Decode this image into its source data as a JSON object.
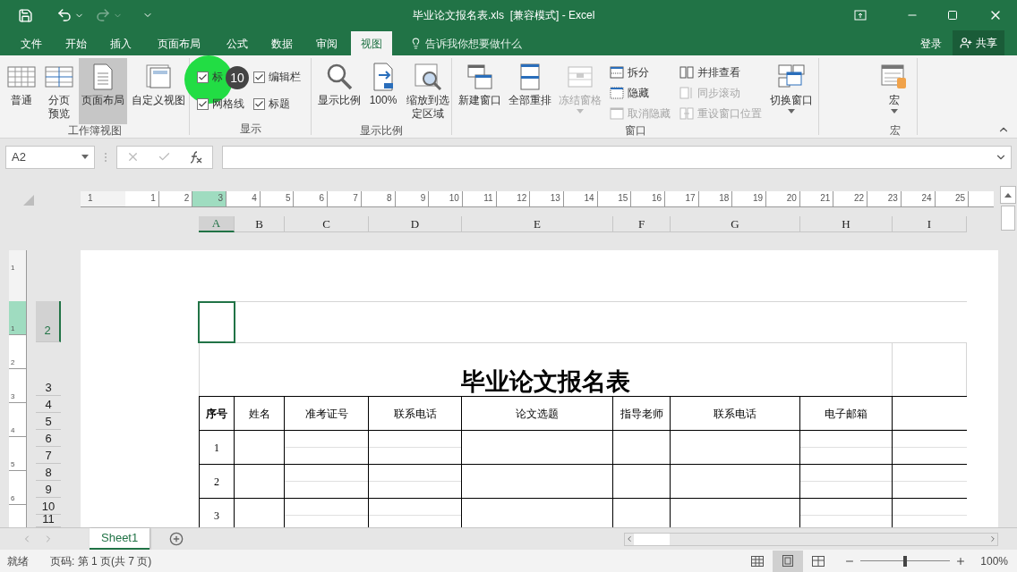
{
  "title_bar": {
    "title": "毕业论文报名表.xls  [兼容模式] - Excel"
  },
  "menu_tabs": [
    {
      "label": "文件",
      "selected": false
    },
    {
      "label": "开始",
      "selected": false
    },
    {
      "label": "插入",
      "selected": false
    },
    {
      "label": "页面布局",
      "selected": false
    },
    {
      "label": "公式",
      "selected": false
    },
    {
      "label": "数据",
      "selected": false
    },
    {
      "label": "审阅",
      "selected": false
    },
    {
      "label": "视图",
      "selected": true
    }
  ],
  "tell_me": {
    "placeholder": "告诉我你想要做什么"
  },
  "account": {
    "sign_in": "登录",
    "share": "共享"
  },
  "ribbon": {
    "groups": [
      {
        "label": "工作簿视图",
        "items": [
          {
            "kind": "large",
            "label": "普通",
            "selected": false
          },
          {
            "kind": "large",
            "label": "分页预览",
            "selected": false
          },
          {
            "kind": "large",
            "label": "页面布局",
            "selected": true
          },
          {
            "kind": "large",
            "label": "自定义视图",
            "selected": false
          }
        ]
      },
      {
        "label": "显示",
        "items": [
          {
            "kind": "stack",
            "items": [
              {
                "kind": "check",
                "label": "标",
                "checked": true
              },
              {
                "kind": "check",
                "label": "网格线",
                "checked": true
              }
            ]
          },
          {
            "kind": "stack",
            "items": [
              {
                "kind": "check",
                "label": "编辑栏",
                "checked": true
              },
              {
                "kind": "check",
                "label": "标题",
                "checked": true
              }
            ]
          }
        ]
      },
      {
        "label": "显示比例",
        "items": [
          {
            "kind": "large",
            "label": "显示比例"
          },
          {
            "kind": "large",
            "label": "100%"
          },
          {
            "kind": "large",
            "label": "缩放到选定区域"
          }
        ]
      },
      {
        "label": "窗口",
        "items": [
          {
            "kind": "large",
            "label": "新建窗口",
            "disabled": false,
            "menu": false
          },
          {
            "kind": "large",
            "label": "全部重排",
            "disabled": false,
            "menu": false
          },
          {
            "kind": "large",
            "label": "冻结窗格",
            "disabled": true,
            "menu": true
          },
          {
            "kind": "stack",
            "items": [
              {
                "kind": "small",
                "label": "拆分",
                "disabled": false
              },
              {
                "kind": "small",
                "label": "隐藏",
                "disabled": false
              },
              {
                "kind": "small",
                "label": "取消隐藏",
                "disabled": true
              }
            ]
          },
          {
            "kind": "stack",
            "items": [
              {
                "kind": "small",
                "label": "并排查看",
                "disabled": false
              },
              {
                "kind": "small",
                "label": "同步滚动",
                "disabled": true
              },
              {
                "kind": "small",
                "label": "重设窗口位置",
                "disabled": true
              }
            ]
          },
          {
            "kind": "large",
            "label": "切换窗口",
            "disabled": false,
            "menu": true
          }
        ]
      },
      {
        "label": "宏",
        "items": [
          {
            "kind": "large",
            "label": "宏",
            "disabled": false,
            "menu": true
          }
        ]
      }
    ]
  },
  "click_marker": {
    "label": "10"
  },
  "name_box": {
    "value": "A2"
  },
  "ruler": {
    "horizontal": [
      "1",
      "1",
      "2",
      "3",
      "4",
      "5",
      "6",
      "7",
      "8",
      "9",
      "10",
      "11",
      "12",
      "13",
      "14",
      "15",
      "16",
      "17",
      "18",
      "19",
      "20",
      "21",
      "22",
      "23",
      "24",
      "25"
    ],
    "vertical": [
      "1",
      "1",
      "2",
      "3",
      "4",
      "5",
      "6"
    ]
  },
  "column_headers": [
    {
      "label": "A",
      "selected": true
    },
    {
      "label": "B",
      "selected": false
    },
    {
      "label": "C",
      "selected": false
    },
    {
      "label": "D",
      "selected": false
    },
    {
      "label": "E",
      "selected": false
    },
    {
      "label": "F",
      "selected": false
    },
    {
      "label": "G",
      "selected": false
    },
    {
      "label": "H",
      "selected": false
    },
    {
      "label": "I",
      "selected": false
    }
  ],
  "row_headers": [
    {
      "label": "2",
      "selected": true
    },
    {
      "label": "3",
      "selected": false
    },
    {
      "label": "4",
      "selected": false
    },
    {
      "label": "5",
      "selected": false
    },
    {
      "label": "6",
      "selected": false
    },
    {
      "label": "7",
      "selected": false
    },
    {
      "label": "8",
      "selected": false
    },
    {
      "label": "9",
      "selected": false
    },
    {
      "label": "10",
      "selected": false
    },
    {
      "label": "11",
      "selected": false
    }
  ],
  "sheet": {
    "title": "毕业论文报名表",
    "columns": [
      "序号",
      "姓名",
      "准考证号",
      "联系电话",
      "论文选题",
      "指导老师",
      "联系电话",
      "电子邮箱"
    ],
    "rows": [
      {
        "no": "1"
      },
      {
        "no": "2"
      },
      {
        "no": "3"
      }
    ]
  },
  "sheet_tabs": [
    {
      "label": "Sheet1",
      "selected": true
    }
  ],
  "status_bar": {
    "status": "就绪",
    "page": "页码: 第 1 页(共 7 页)",
    "views": [
      {
        "kind": "normal",
        "selected": false
      },
      {
        "kind": "page_layout",
        "selected": true
      },
      {
        "kind": "page_break",
        "selected": false
      }
    ],
    "zoom": {
      "level": 0.5,
      "reading": "100%"
    }
  }
}
